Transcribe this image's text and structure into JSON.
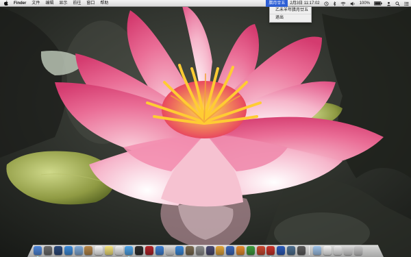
{
  "menubar": {
    "app_name": "Finder",
    "menus": [
      "文件",
      "编辑",
      "显示",
      "前往",
      "窗口",
      "帮助"
    ],
    "lunar_label": "腊月廿五",
    "date_time": "2月3日  11:17:02",
    "battery": "100%",
    "icons": [
      "apple-icon",
      "time-machine-icon",
      "bluetooth-icon",
      "wifi-icon",
      "volume-icon",
      "battery-icon",
      "user-icon",
      "spotlight-icon",
      "notification-icon"
    ]
  },
  "lunar_menu": {
    "detail": "乙未羊年腊月廿五",
    "quit_label": "退出"
  },
  "dock": {
    "apps": [
      {
        "name": "finder-icon",
        "color": "#4f86d9",
        "running": true
      },
      {
        "name": "launchpad-icon",
        "color": "#6b6b6b",
        "running": false
      },
      {
        "name": "mission-control-icon",
        "color": "#2d4a7a",
        "running": false
      },
      {
        "name": "safari-icon",
        "color": "#3d8ad8",
        "running": false
      },
      {
        "name": "mail-icon",
        "color": "#7fa9d6",
        "running": false
      },
      {
        "name": "contacts-icon",
        "color": "#b6874a",
        "running": false
      },
      {
        "name": "calendar-icon",
        "color": "#f3f3f3",
        "running": false
      },
      {
        "name": "notes-icon",
        "color": "#f2e07a",
        "running": false
      },
      {
        "name": "reminders-icon",
        "color": "#ececec",
        "running": false
      },
      {
        "name": "messages-icon",
        "color": "#4fa3e6",
        "running": true
      },
      {
        "name": "facetime-icon",
        "color": "#2e2e2e",
        "running": false
      },
      {
        "name": "photo-booth-icon",
        "color": "#b0242a",
        "running": false
      },
      {
        "name": "itunes-icon",
        "color": "#3f7fd0",
        "running": false
      },
      {
        "name": "game-center-icon",
        "color": "#d7d7d7",
        "running": false
      },
      {
        "name": "app-store-icon",
        "color": "#3a87d8",
        "running": false
      },
      {
        "name": "preview-icon",
        "color": "#7a6a50",
        "running": false
      },
      {
        "name": "system-preferences-icon",
        "color": "#8a8a8a",
        "running": false
      },
      {
        "name": "imovie-icon",
        "color": "#4a4a70",
        "running": false
      },
      {
        "name": "photos-icon",
        "color": "#e0a33a",
        "running": false
      },
      {
        "name": "keynote-icon",
        "color": "#3a66b8",
        "running": false
      },
      {
        "name": "pages-icon",
        "color": "#e58a2e",
        "running": false
      },
      {
        "name": "numbers-icon",
        "color": "#3d9a3d",
        "running": false
      },
      {
        "name": "garageband-icon",
        "color": "#c8472f",
        "running": false
      },
      {
        "name": "lunar-calendar-icon",
        "color": "#c7322a",
        "running": true
      },
      {
        "name": "dvd-player-icon",
        "color": "#2b5ab8",
        "running": false
      },
      {
        "name": "time-machine-dock-icon",
        "color": "#4e6f8f",
        "running": false
      },
      {
        "name": "utilities-icon",
        "color": "#5b5b5b",
        "running": false
      }
    ],
    "stacks": [
      {
        "name": "applications-folder-icon",
        "color": "#9ec2e8"
      },
      {
        "name": "documents-stack-icon",
        "color": "#f1f1f1"
      },
      {
        "name": "downloads-stack-icon",
        "color": "#e8e8e8"
      },
      {
        "name": "screenshots-stack-icon",
        "color": "#d8d8d8"
      },
      {
        "name": "trash-icon",
        "color": "#c9c9c9"
      }
    ]
  }
}
